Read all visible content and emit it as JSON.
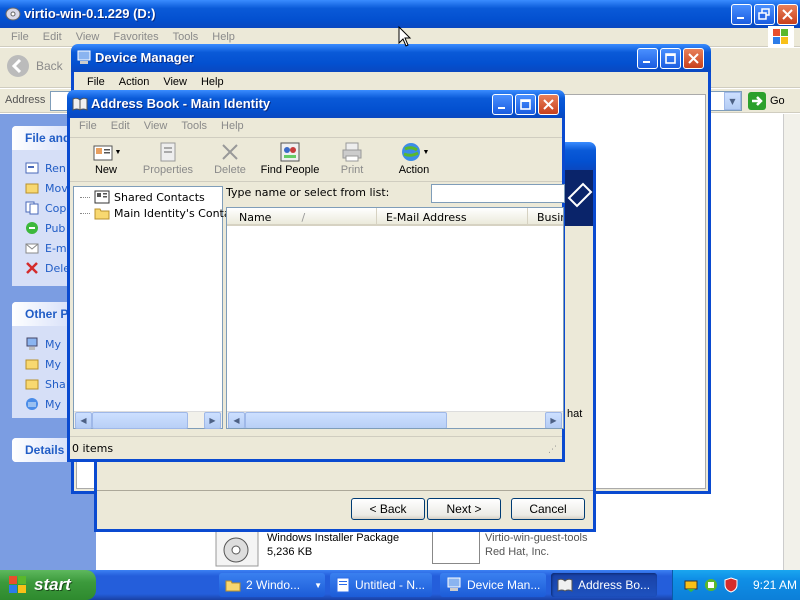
{
  "explorer": {
    "title": "virtio-win-0.1.229 (D:)",
    "menu": [
      "File",
      "Edit",
      "View",
      "Favorites",
      "Tools",
      "Help"
    ],
    "back_label": "Back",
    "address_label": "Address",
    "go_label": "Go",
    "task_title": "File and",
    "task_items": [
      "Ren",
      "Mov",
      "Cop",
      "Pub",
      "E-m",
      "Dele"
    ],
    "other_title": "Other P",
    "other_items": [
      "My",
      "My",
      "Sha",
      "My"
    ],
    "details_title": "Details",
    "files": [
      {
        "name": "Windows Installer Package",
        "detail": "5,236 KB"
      },
      {
        "name": "Virtio-win-guest-tools",
        "detail": "Red Hat, Inc."
      }
    ]
  },
  "device_manager": {
    "title": "Device Manager",
    "menu": [
      "File",
      "Action",
      "View",
      "Help"
    ]
  },
  "wizard": {
    "partial_text": "hat",
    "back_label": "< Back",
    "next_label": "Next >",
    "cancel_label": "Cancel"
  },
  "address_book": {
    "title": "Address Book - Main Identity",
    "menu": [
      "File",
      "Edit",
      "View",
      "Tools",
      "Help"
    ],
    "toolbar": {
      "new": "New",
      "properties": "Properties",
      "delete": "Delete",
      "find_people": "Find People",
      "print": "Print",
      "action": "Action"
    },
    "tree": [
      "Shared Contacts",
      "Main Identity's Conta"
    ],
    "search_label": "Type name or select from list:",
    "search_value": "",
    "columns": [
      "Name",
      "E-Mail Address",
      "Busine"
    ],
    "status": "0 items"
  },
  "taskbar": {
    "start": "start",
    "tasks": [
      "2 Windo...",
      "Untitled - N...",
      "Device Man...",
      "Address Bo..."
    ],
    "clock": "9:21 AM"
  },
  "colors": {
    "titlebar": "#0a5ad8",
    "taskbar": "#245edb",
    "start": "#3c9a3c",
    "tray": "#0f8fe6",
    "panel_bg": "#6d8fde"
  }
}
